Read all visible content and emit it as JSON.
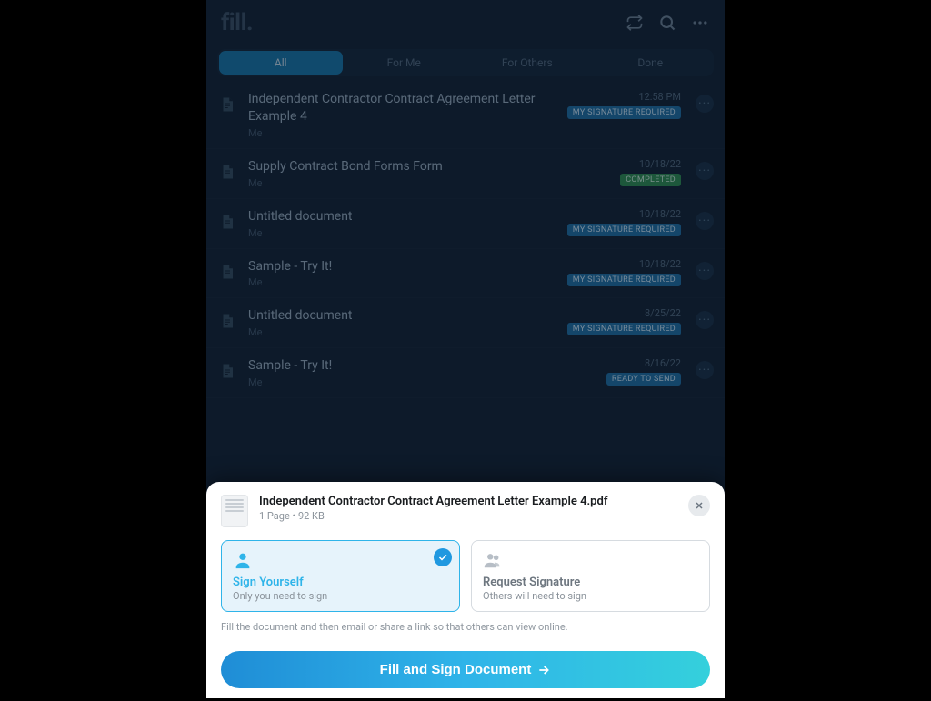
{
  "header": {
    "logo": "fill."
  },
  "tabs": [
    {
      "label": "All",
      "active": true
    },
    {
      "label": "For Me",
      "active": false
    },
    {
      "label": "For Others",
      "active": false
    },
    {
      "label": "Done",
      "active": false
    }
  ],
  "status_labels": {
    "signature": "MY SIGNATURE REQUIRED",
    "completed": "COMPLETED",
    "ready": "READY TO SEND"
  },
  "documents": [
    {
      "title": "Independent Contractor Contract Agreement Letter Example 4",
      "owner": "Me",
      "date": "12:58 PM",
      "status": "signature"
    },
    {
      "title": "Supply Contract Bond Forms Form",
      "owner": "Me",
      "date": "10/18/22",
      "status": "completed"
    },
    {
      "title": "Untitled document",
      "owner": "Me",
      "date": "10/18/22",
      "status": "signature"
    },
    {
      "title": "Sample - Try It!",
      "owner": "Me",
      "date": "10/18/22",
      "status": "signature"
    },
    {
      "title": "Untitled document",
      "owner": "Me",
      "date": "8/25/22",
      "status": "signature"
    },
    {
      "title": "Sample - Try It!",
      "owner": "Me",
      "date": "8/16/22",
      "status": "ready"
    }
  ],
  "sheet": {
    "title": "Independent Contractor Contract Agreement Letter Example 4.pdf",
    "meta": "1 Page • 92 KB",
    "options": {
      "self": {
        "title": "Sign Yourself",
        "sub": "Only you need to sign",
        "selected": true
      },
      "request": {
        "title": "Request Signature",
        "sub": "Others will need to sign",
        "selected": false
      }
    },
    "help": "Fill the document and then email or share a link so that others can view online.",
    "cta": "Fill and Sign Document"
  }
}
